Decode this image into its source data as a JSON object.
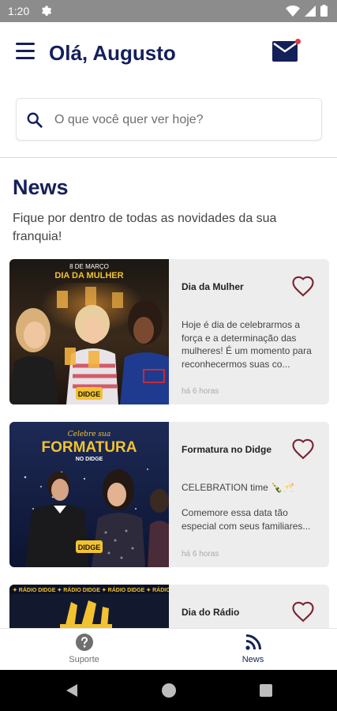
{
  "status_bar": {
    "time": "1:20"
  },
  "header": {
    "greeting": "Olá, Augusto",
    "notification_dot_color": "#e63946"
  },
  "search": {
    "placeholder": "O que você quer ver hoje?"
  },
  "section": {
    "title": "News",
    "subtitle": "Fique por dentro de todas as novidades da sua franquia!"
  },
  "news": [
    {
      "title": "Dia da Mulher",
      "banner_date": "8 DE MARÇO",
      "banner_title": "DIA DA MULHER",
      "logo": "DIDGE",
      "body_1": "Hoje é dia de celebrarmos a força e a determinação das mulheres! É um momento para reconhecermos suas co...",
      "body_2": "",
      "time": "há 6 horas"
    },
    {
      "title": "Formatura no Didge",
      "banner_script": "Celebre sua",
      "banner_title": "FORMATURA",
      "banner_sub": "NO DIDGE",
      "logo": "DIDGE",
      "body_1": "CELEBRATION time 🍾🥂",
      "body_2": "Comemore essa data tão especial com seus familiares...",
      "time": "há 6 horas"
    },
    {
      "title": "Dia do Rádio",
      "banner_strip": "✦ RÁDIO DIDGE ✦ RÁDIO DIDGE ✦ RÁDIO DIDGE ✦ RÁDIO DIDGE",
      "body_1": "",
      "body_2": "",
      "time": ""
    }
  ],
  "bottom_nav": [
    {
      "label": "Suporte",
      "icon": "help-circle-icon",
      "active": false
    },
    {
      "label": "News",
      "icon": "rss-feed-icon",
      "active": true
    }
  ],
  "colors": {
    "brand_navy": "#14205a",
    "heart": "#7a2330",
    "nav_inactive": "#6f6f6f",
    "nav_active": "#14205a",
    "card_bg": "#ededed"
  }
}
